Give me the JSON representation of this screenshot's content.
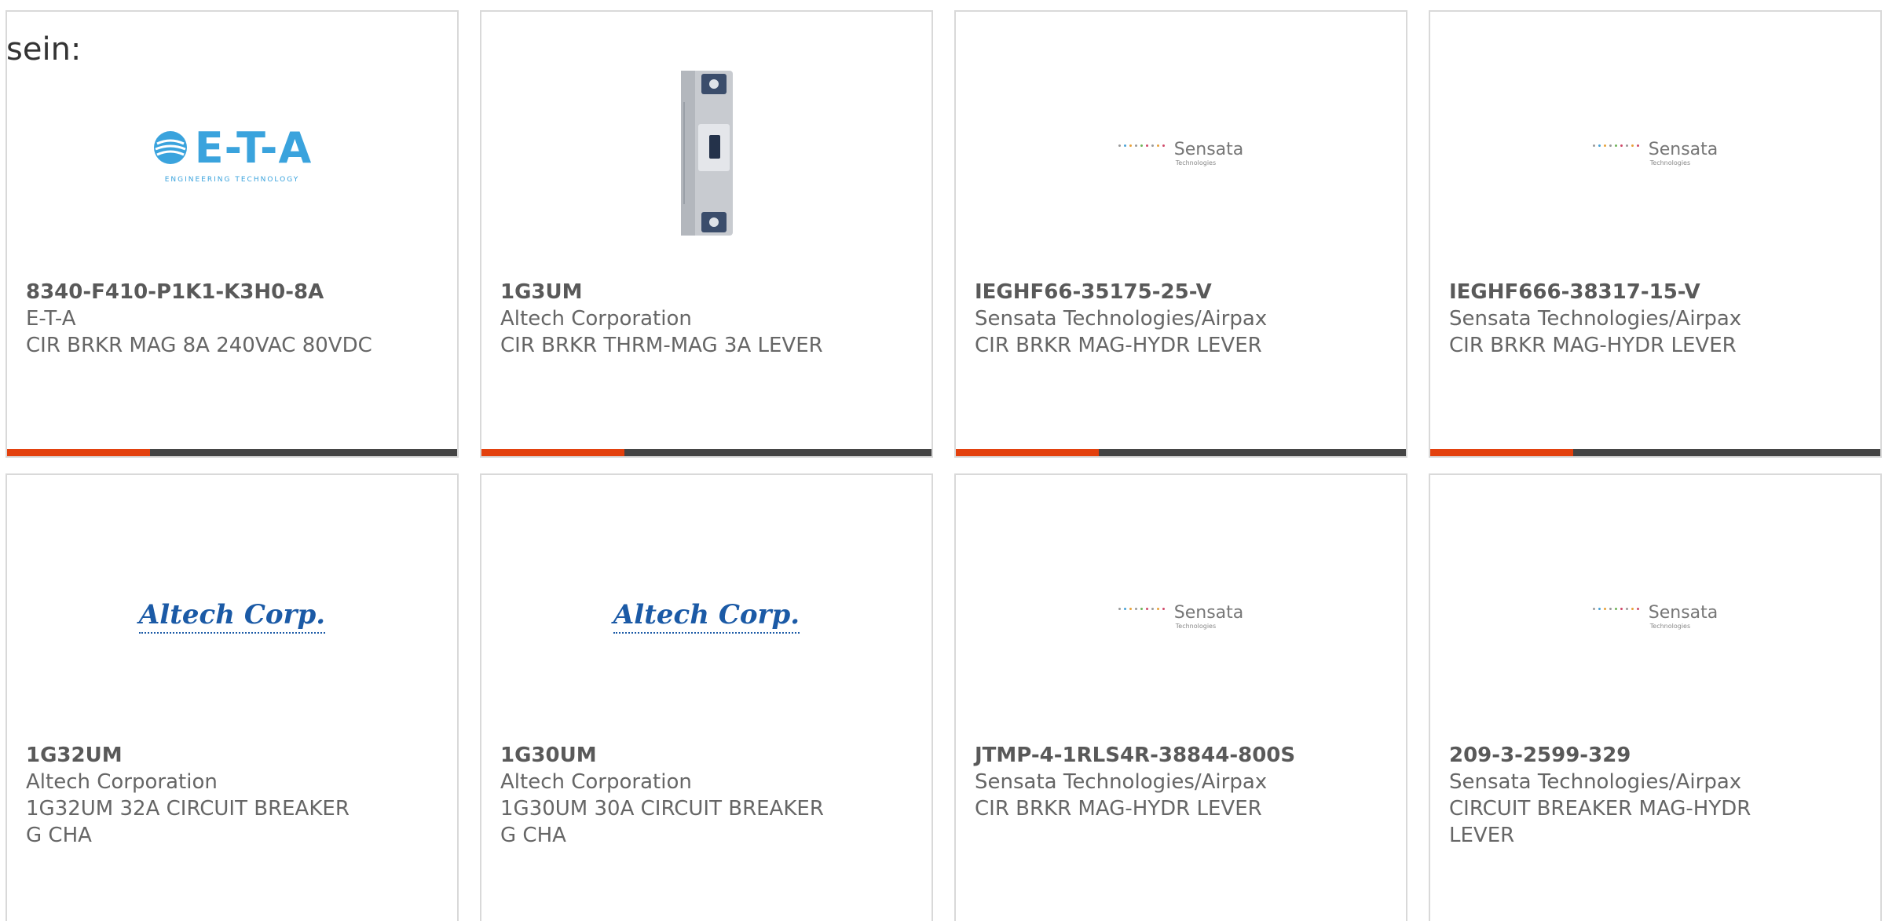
{
  "intro_text": "sein:",
  "colors": {
    "accent": "#e3400d",
    "bar": "#444444",
    "card_border": "#d9d9d9",
    "text": "#666666"
  },
  "logos": {
    "eta": {
      "name": "E-T-A",
      "sub": "ENGINEERING TECHNOLOGY"
    },
    "altech": {
      "name": "Altech Corp."
    },
    "sensata": {
      "name": "Sensata",
      "sub": "Technologies"
    }
  },
  "products": [
    {
      "part": "8340-F410-P1K1-K3H0-8A",
      "maker": "E-T-A",
      "desc": "CIR BRKR MAG 8A 240VAC 80VDC",
      "image": "eta-logo"
    },
    {
      "part": "1G3UM",
      "maker": "Altech Corporation",
      "desc": "CIR BRKR THRM-MAG 3A LEVER",
      "image": "circuit-breaker-photo"
    },
    {
      "part": "IEGHF66-35175-25-V",
      "maker": "Sensata Technologies/Airpax",
      "desc": "CIR BRKR MAG-HYDR LEVER",
      "image": "sensata-logo"
    },
    {
      "part": "IEGHF666-38317-15-V",
      "maker": "Sensata Technologies/Airpax",
      "desc": "CIR BRKR MAG-HYDR LEVER",
      "image": "sensata-logo"
    },
    {
      "part": "1G32UM",
      "maker": "Altech Corporation",
      "desc": "1G32UM 32A CIRCUIT BREAKER G CHA",
      "image": "altech-logo"
    },
    {
      "part": "1G30UM",
      "maker": "Altech Corporation",
      "desc": "1G30UM 30A CIRCUIT BREAKER G CHA",
      "image": "altech-logo"
    },
    {
      "part": "JTMP-4-1RLS4R-38844-800S",
      "maker": "Sensata Technologies/Airpax",
      "desc": "CIR BRKR MAG-HYDR LEVER",
      "image": "sensata-logo"
    },
    {
      "part": "209-3-2599-329",
      "maker": "Sensata Technologies/Airpax",
      "desc": "CIRCUIT BREAKER MAG-HYDR LEVER",
      "image": "sensata-logo"
    }
  ]
}
